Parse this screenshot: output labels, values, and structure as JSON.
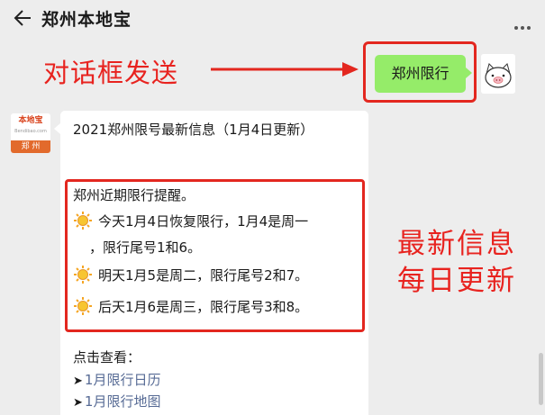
{
  "header": {
    "title": "郑州本地宝"
  },
  "annotations": {
    "send_label": "对话框发送",
    "daily_line1": "最新信息",
    "daily_line2": "每日更新",
    "color": "#e3271f"
  },
  "sent_message": {
    "text": "郑州限行",
    "bubble_color": "#95ec69"
  },
  "bot_avatar": {
    "logo_text": "本地宝",
    "logo_url": "Bendibao.com",
    "city_label": "郑 州"
  },
  "received_message": {
    "headline": "2021郑州限号最新信息（1月4日更新）",
    "reminder_title": "郑州近期限行提醒。",
    "items": [
      {
        "line1": "今天1月4日恢复限行，1月4是周一",
        "line2": "，限行尾号1和6。"
      },
      {
        "line1": "明天1月5是周二，限行尾号2和7。"
      },
      {
        "line1": "后天1月6是周三，限行尾号3和8。"
      }
    ],
    "check_label": "点击查看：",
    "links": [
      {
        "label": "1月限行日历"
      },
      {
        "label": "1月限行地图"
      }
    ],
    "link_color": "#576b95"
  }
}
